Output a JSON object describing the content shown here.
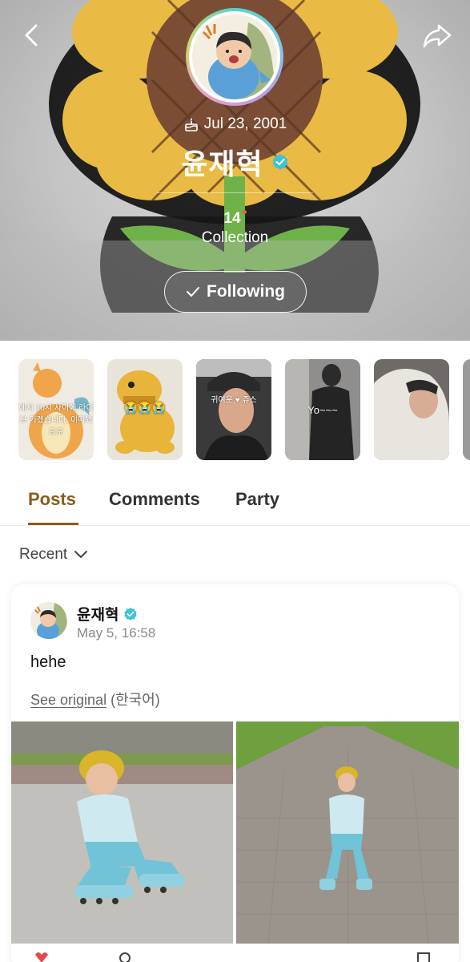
{
  "header": {
    "birthday": "Jul 23, 2001",
    "name": "윤재혁",
    "collection_count": "14",
    "collection_label": "Collection",
    "follow_label": "Following"
  },
  "stories": [
    {
      "caption": "에서 10시 사이에 라이브 키겠습니다. 이따봐요오"
    },
    {
      "caption": "😭😭😭"
    },
    {
      "caption": "귀여운 ♥ 쥬스"
    },
    {
      "caption": "Yo~~~"
    },
    {
      "caption": ""
    }
  ],
  "tabs": [
    {
      "label": "Posts",
      "active": true
    },
    {
      "label": "Comments",
      "active": false
    },
    {
      "label": "Party",
      "active": false
    }
  ],
  "sort": {
    "label": "Recent"
  },
  "post": {
    "author": "윤재혁",
    "time": "May 5, 16:58",
    "text": "hehe",
    "see_original": "See original",
    "language": "(한국어)"
  },
  "colors": {
    "accent": "#8c5b19",
    "verified": "#3cc3d6",
    "notification_dot": "#f15a3c"
  }
}
